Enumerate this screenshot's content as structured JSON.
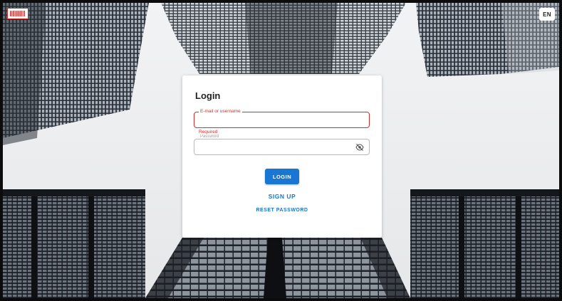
{
  "header": {
    "language": "EN",
    "logo_icon": "barcode-logo-icon"
  },
  "login": {
    "title": "Login",
    "email_label": "E-mail or username",
    "email_value": "",
    "email_error": "Required",
    "password_label": "Password",
    "password_value": "",
    "password_toggle_icon": "eye-off-icon",
    "login_label": "LOGIN",
    "signup_label": "SIGN UP",
    "reset_label": "RESET PASSWORD"
  },
  "colors": {
    "primary": "#1976d2",
    "error": "#d32f2f",
    "logo_red": "#c62828"
  }
}
